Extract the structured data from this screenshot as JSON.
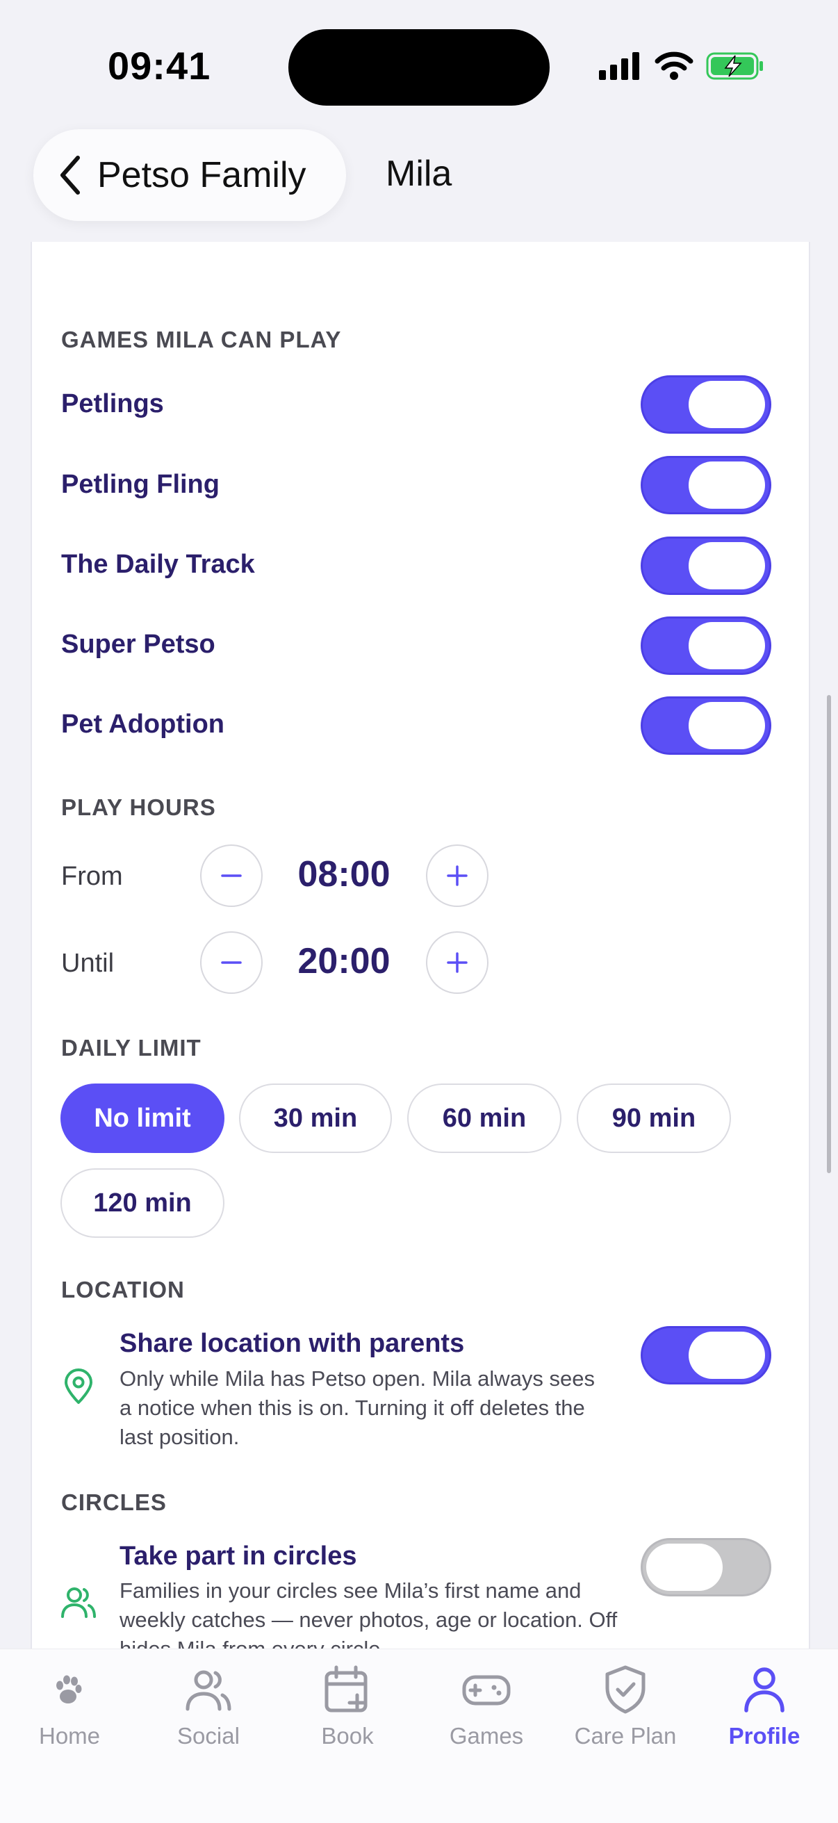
{
  "status_bar": {
    "time": "09:41"
  },
  "nav": {
    "back_label": "Petso Family",
    "title": "Mila"
  },
  "games": {
    "heading": "GAMES MILA CAN PLAY",
    "items": [
      {
        "label": "Petlings",
        "enabled": true
      },
      {
        "label": "Petling Fling",
        "enabled": true
      },
      {
        "label": "The Daily Track",
        "enabled": true
      },
      {
        "label": "Super Petso",
        "enabled": true
      },
      {
        "label": "Pet Adoption",
        "enabled": true
      }
    ]
  },
  "play_hours": {
    "heading": "PLAY HOURS",
    "from_label": "From",
    "from_value": "08:00",
    "until_label": "Until",
    "until_value": "20:00"
  },
  "daily_limit": {
    "heading": "DAILY LIMIT",
    "options": [
      "No limit",
      "30 min",
      "60 min",
      "90 min",
      "120 min"
    ],
    "selected": "No limit"
  },
  "location": {
    "heading": "LOCATION",
    "title": "Share location with parents",
    "description": "Only while Mila has Petso open. Mila always sees a notice when this is on. Turning it off deletes the last position.",
    "enabled": true
  },
  "circles": {
    "heading": "CIRCLES",
    "title": "Take part in circles",
    "description": "Families in your circles see Mila’s first name and weekly catches — never photos, age or location. Off hides Mila from every circle.",
    "enabled": false
  },
  "tabbar": {
    "items": [
      {
        "label": "Home",
        "icon": "paw-icon"
      },
      {
        "label": "Social",
        "icon": "users-icon"
      },
      {
        "label": "Book",
        "icon": "calendar-plus-icon"
      },
      {
        "label": "Games",
        "icon": "gamepad-icon"
      },
      {
        "label": "Care Plan",
        "icon": "shield-check-icon"
      },
      {
        "label": "Profile",
        "icon": "user-icon"
      }
    ],
    "active": "Profile"
  },
  "colors": {
    "accent": "#5b4ff5",
    "text_primary": "#2b1f6b",
    "toggle_off": "#c6c6c8",
    "location_icon": "#2fb36b"
  }
}
